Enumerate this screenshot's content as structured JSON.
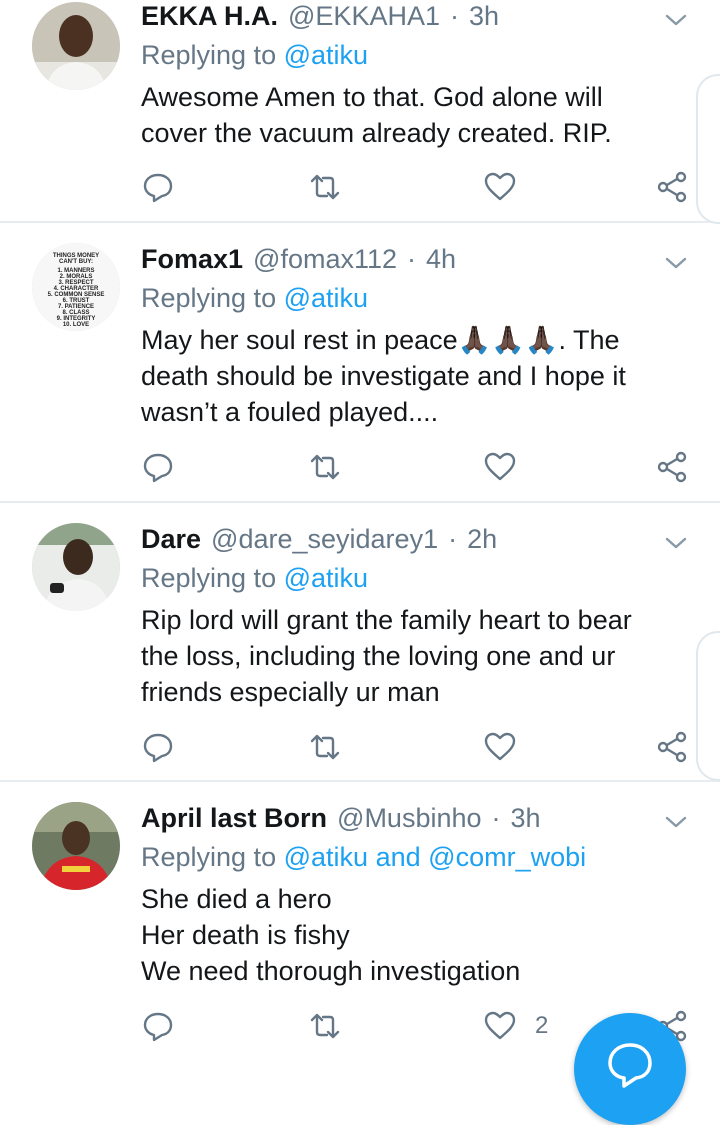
{
  "tweets": [
    {
      "name": "EKKA H.A.",
      "handle": "@EKKAHA1",
      "separator": "·",
      "time": "3h",
      "replying_prefix": "Replying to",
      "mentions": [
        "@atiku"
      ],
      "mention_joiner": "",
      "text_lines": [
        "Awesome Amen to that. God alone will",
        "cover the vacuum already created. RIP."
      ],
      "like_count": ""
    },
    {
      "name": "Fomax1",
      "handle": "@fomax112",
      "separator": "·",
      "time": "4h",
      "replying_prefix": "Replying to",
      "mentions": [
        "@atiku"
      ],
      "mention_joiner": "",
      "text_lines": [
        "May her soul rest in peace🙏🏿🙏🏿🙏🏿. The",
        "death should be investigate and I hope it",
        "wasn’t a fouled played...."
      ],
      "avatar_text": [
        "THINGS MONEY",
        "CAN'T BUY:",
        "1. MANNERS",
        "2. MORALS",
        "3. RESPECT",
        "4. CHARACTER",
        "5. COMMON SENSE",
        "6. TRUST",
        "7. PATIENCE",
        "8. CLASS",
        "9. INTEGRITY",
        "10. LOVE"
      ],
      "like_count": ""
    },
    {
      "name": "Dare",
      "handle": "@dare_seyidarey1",
      "separator": "·",
      "time": "2h",
      "replying_prefix": "Replying to",
      "mentions": [
        "@atiku"
      ],
      "mention_joiner": "",
      "text_lines": [
        "Rip  lord will grant the family heart to bear",
        "the loss, including the loving one and ur",
        "friends especially ur man"
      ],
      "like_count": ""
    },
    {
      "name": "April last Born",
      "handle": "@Musbinho",
      "separator": "·",
      "time": "3h",
      "replying_prefix": "Replying to",
      "mentions": [
        "@atiku",
        "@comr_wobi"
      ],
      "mention_joiner": "and",
      "text_lines": [
        "She died a hero",
        "Her death is fishy",
        "We need thorough investigation"
      ],
      "like_count": "2"
    }
  ],
  "icons": {
    "reply": "reply-icon",
    "retweet": "retweet-icon",
    "like": "heart-icon",
    "share": "share-icon",
    "menu": "chevron-down-icon",
    "compose": "compose-reply-icon"
  },
  "colors": {
    "accent": "#1da1f2",
    "secondary_text": "#657786",
    "primary_text": "#14171a",
    "divider": "#e6ecf0"
  }
}
